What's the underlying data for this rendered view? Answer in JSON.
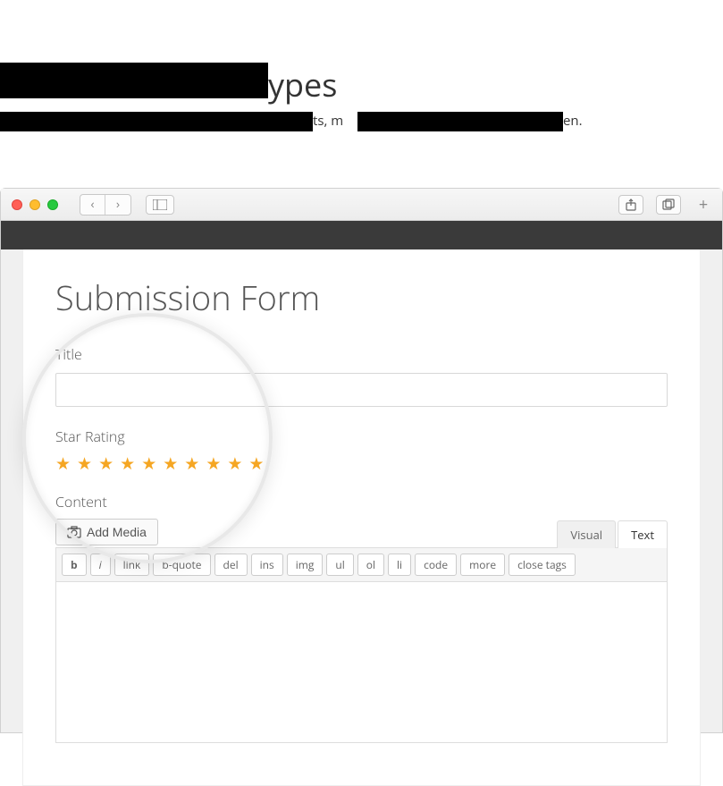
{
  "partial_text": {
    "heading_fragment": "ypes",
    "sub_fragment_1": "ts, m",
    "sub_fragment_2": "en."
  },
  "browser": {
    "share_label": "Share",
    "tabs_label": "Tabs"
  },
  "form": {
    "heading": "Submission Form",
    "title_label": "Title",
    "title_value": "",
    "star_rating_label": "Star Rating",
    "star_count": 10,
    "content_label": "Content"
  },
  "editor": {
    "add_media": "Add Media",
    "tabs": {
      "visual": "Visual",
      "text": "Text"
    },
    "quicktags": [
      "b",
      "i",
      "link",
      "b-quote",
      "del",
      "ins",
      "img",
      "ul",
      "ol",
      "li",
      "code",
      "more",
      "close tags"
    ]
  }
}
